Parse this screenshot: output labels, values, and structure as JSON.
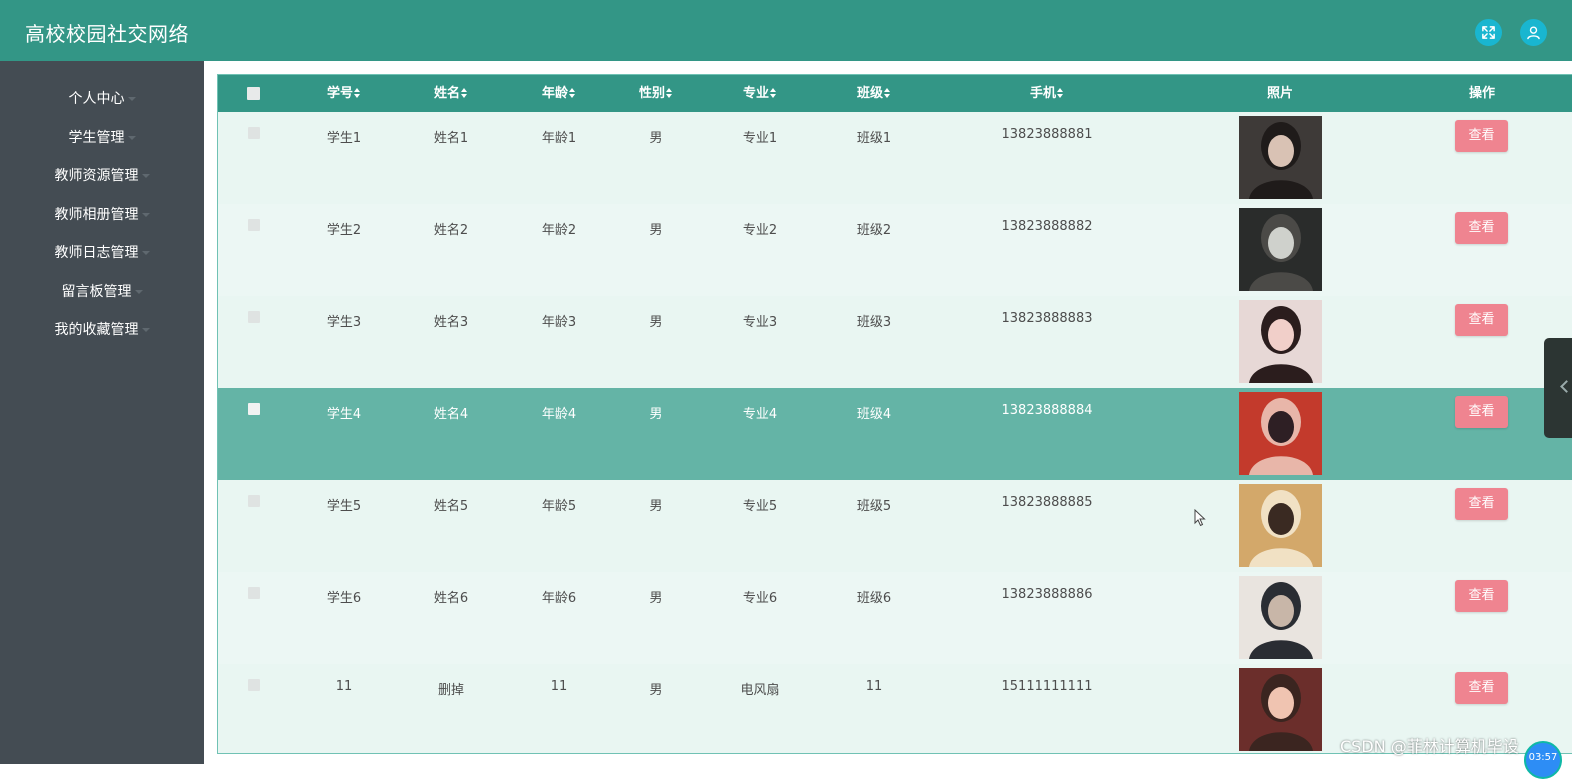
{
  "header": {
    "title": "高校校园社交网络",
    "fullscreen_icon": "expand-icon",
    "user_icon": "user-icon"
  },
  "sidebar": {
    "items": [
      {
        "label": "个人中心"
      },
      {
        "label": "学生管理"
      },
      {
        "label": "教师资源管理"
      },
      {
        "label": "教师相册管理"
      },
      {
        "label": "教师日志管理"
      },
      {
        "label": "留言板管理"
      },
      {
        "label": "我的收藏管理"
      }
    ]
  },
  "table": {
    "columns": [
      "学号",
      "姓名",
      "年龄",
      "性别",
      "专业",
      "班级",
      "手机",
      "照片",
      "操作"
    ],
    "rows": [
      {
        "student_id": "学生1",
        "name": "姓名1",
        "age": "年龄1",
        "gender": "男",
        "major": "专业1",
        "class": "班级1",
        "phone": "13823888881",
        "action": "查看"
      },
      {
        "student_id": "学生2",
        "name": "姓名2",
        "age": "年龄2",
        "gender": "男",
        "major": "专业2",
        "class": "班级2",
        "phone": "13823888882",
        "action": "查看"
      },
      {
        "student_id": "学生3",
        "name": "姓名3",
        "age": "年龄3",
        "gender": "男",
        "major": "专业3",
        "class": "班级3",
        "phone": "13823888883",
        "action": "查看"
      },
      {
        "student_id": "学生4",
        "name": "姓名4",
        "age": "年龄4",
        "gender": "男",
        "major": "专业4",
        "class": "班级4",
        "phone": "13823888884",
        "action": "查看"
      },
      {
        "student_id": "学生5",
        "name": "姓名5",
        "age": "年龄5",
        "gender": "男",
        "major": "专业5",
        "class": "班级5",
        "phone": "13823888885",
        "action": "查看"
      },
      {
        "student_id": "学生6",
        "name": "姓名6",
        "age": "年龄6",
        "gender": "男",
        "major": "专业6",
        "class": "班级6",
        "phone": "13823888886",
        "action": "查看"
      },
      {
        "student_id": "11",
        "name": "删掉",
        "age": "11",
        "gender": "男",
        "major": "电风扇",
        "class": "11",
        "phone": "15111111111",
        "action": "查看"
      }
    ],
    "selected_row": 4
  },
  "overlay": {
    "watermark": "CSDN @菲林计算机毕设",
    "timer": "03:57"
  },
  "colors": {
    "header": "#339686",
    "sidebar": "#444c53",
    "selected_row": "#64b4a6",
    "view_button": "#ef8490"
  }
}
